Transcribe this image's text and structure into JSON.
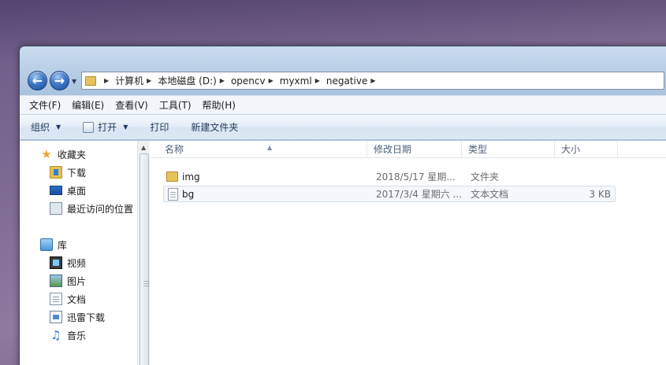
{
  "window": {
    "breadcrumbs": [
      "计算机",
      "本地磁盘 (D:)",
      "opencv",
      "myxml",
      "negative"
    ]
  },
  "menubar": [
    "文件(F)",
    "编辑(E)",
    "查看(V)",
    "工具(T)",
    "帮助(H)"
  ],
  "commandbar": {
    "organize": "组织",
    "open": "打开",
    "print": "打印",
    "new_folder": "新建文件夹"
  },
  "navpane": {
    "favorites": {
      "label": "收藏夹",
      "items": [
        "下载",
        "桌面",
        "最近访问的位置"
      ]
    },
    "libraries": {
      "label": "库",
      "items": [
        "视频",
        "图片",
        "文档",
        "迅雷下载",
        "音乐"
      ]
    }
  },
  "columns": {
    "name": "名称",
    "date": "修改日期",
    "type": "类型",
    "size": "大小"
  },
  "files": [
    {
      "name": "img",
      "date": "2018/5/17 星期...",
      "type": "文件夹",
      "size": ""
    },
    {
      "name": "bg",
      "date": "2017/3/4 星期六 ...",
      "type": "文本文档",
      "size": "3 KB"
    }
  ],
  "colors": {
    "accent": "#1e395b",
    "folder": "#e7c25a",
    "selection_border": "#d6dee8"
  }
}
